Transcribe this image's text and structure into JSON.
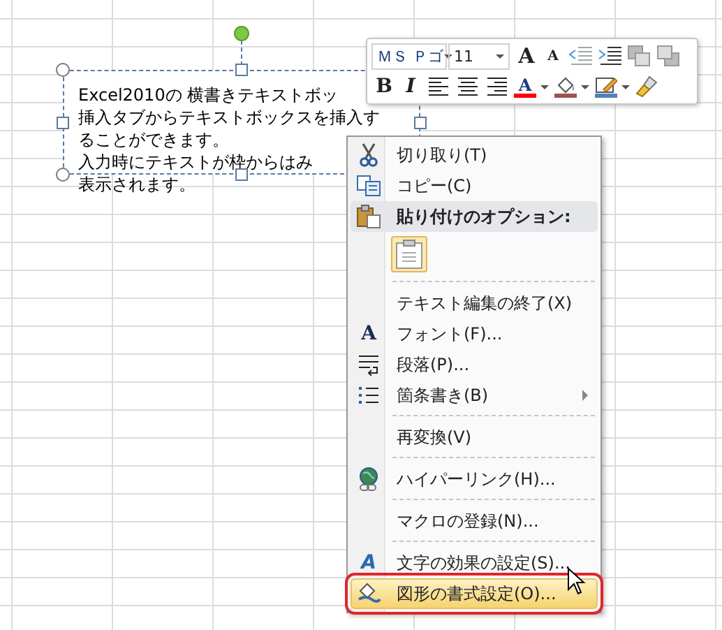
{
  "textbox": {
    "lines": [
      "Excel2010の 横書きテキストボッ",
      "挿入タブからテキストボックスを挿入す",
      "ることができます。",
      "入力時にテキストが枠からはみ",
      "表示されます。"
    ]
  },
  "mini_toolbar": {
    "font_row": [
      {
        "kind": "combo",
        "value": "ＭＳ Ｐゴ"
      },
      {
        "kind": "combo",
        "value": "11"
      },
      {
        "kind": "glyph",
        "glyph": "A"
      },
      {
        "kind": "glyph",
        "glyph": "A"
      },
      {
        "kind": "icon"
      },
      {
        "kind": "icon"
      },
      {
        "kind": "icon"
      },
      {
        "kind": "icon"
      }
    ],
    "format_row": [
      {
        "kind": "glyph",
        "glyph": "B"
      },
      {
        "kind": "glyph",
        "glyph": "I"
      },
      {
        "kind": "icon"
      },
      {
        "kind": "icon"
      },
      {
        "kind": "icon"
      },
      {
        "kind": "color",
        "glyph": "A",
        "color": "#ff0000"
      },
      {
        "kind": "color",
        "color": "#a0504d"
      },
      {
        "kind": "color",
        "color": "#4f81bd"
      },
      {
        "kind": "icon"
      }
    ]
  },
  "context_menu": {
    "items": [
      {
        "kind": "command",
        "label": "切り取り(T)",
        "selected": false
      },
      {
        "kind": "command",
        "label": "コピー(C)",
        "selected": false
      },
      {
        "kind": "header",
        "label": "貼り付けのオプション:"
      },
      {
        "kind": "paste"
      },
      {
        "kind": "separator"
      },
      {
        "kind": "command",
        "label": "テキスト編集の終了(X)",
        "selected": false
      },
      {
        "kind": "command",
        "label": "フォント(F)...",
        "glyph": "A",
        "selected": false
      },
      {
        "kind": "command",
        "label": "段落(P)...",
        "selected": false
      },
      {
        "kind": "command",
        "label": "箇条書き(B)",
        "submenu": true,
        "selected": false
      },
      {
        "kind": "separator"
      },
      {
        "kind": "command",
        "label": "再変換(V)",
        "selected": false
      },
      {
        "kind": "separator"
      },
      {
        "kind": "command",
        "label": "ハイパーリンク(H)...",
        "selected": false
      },
      {
        "kind": "separator"
      },
      {
        "kind": "command",
        "label": "マクロの登録(N)...",
        "selected": false
      },
      {
        "kind": "separator"
      },
      {
        "kind": "command",
        "label": "文字の効果の設定(S)...",
        "glyph": "A",
        "selected": false
      },
      {
        "kind": "command",
        "label": "図形の書式設定(O)...",
        "selected": true
      }
    ]
  }
}
